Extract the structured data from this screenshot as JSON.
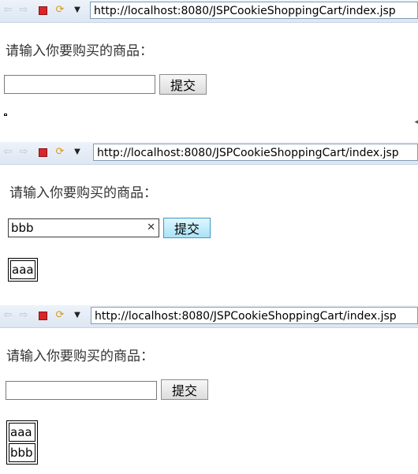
{
  "browser": {
    "url": "http://localhost:8080/JSPCookieShoppingCart/index.jsp",
    "icons": [
      "back-arrow-icon",
      "forward-arrow-icon",
      "stop-icon",
      "refresh-icon",
      "menu-dropdown-icon"
    ]
  },
  "panels": [
    {
      "prompt": "请输入你要购买的商品：",
      "input_value": "",
      "submit_label": "提交",
      "cart_items": []
    },
    {
      "prompt": "请输入你要购买的商品：",
      "input_value": "bbb",
      "submit_label": "提交",
      "cart_items": [
        "aaa"
      ]
    },
    {
      "prompt": "请输入你要购买的商品：",
      "input_value": "",
      "submit_label": "提交",
      "cart_items": [
        "aaa",
        "bbb"
      ]
    }
  ],
  "colors": {
    "toolbar": "#dde6f2",
    "url_border": "#7f9db9",
    "stop": "#d8262a",
    "submit_hover": "#a9e3f8"
  }
}
